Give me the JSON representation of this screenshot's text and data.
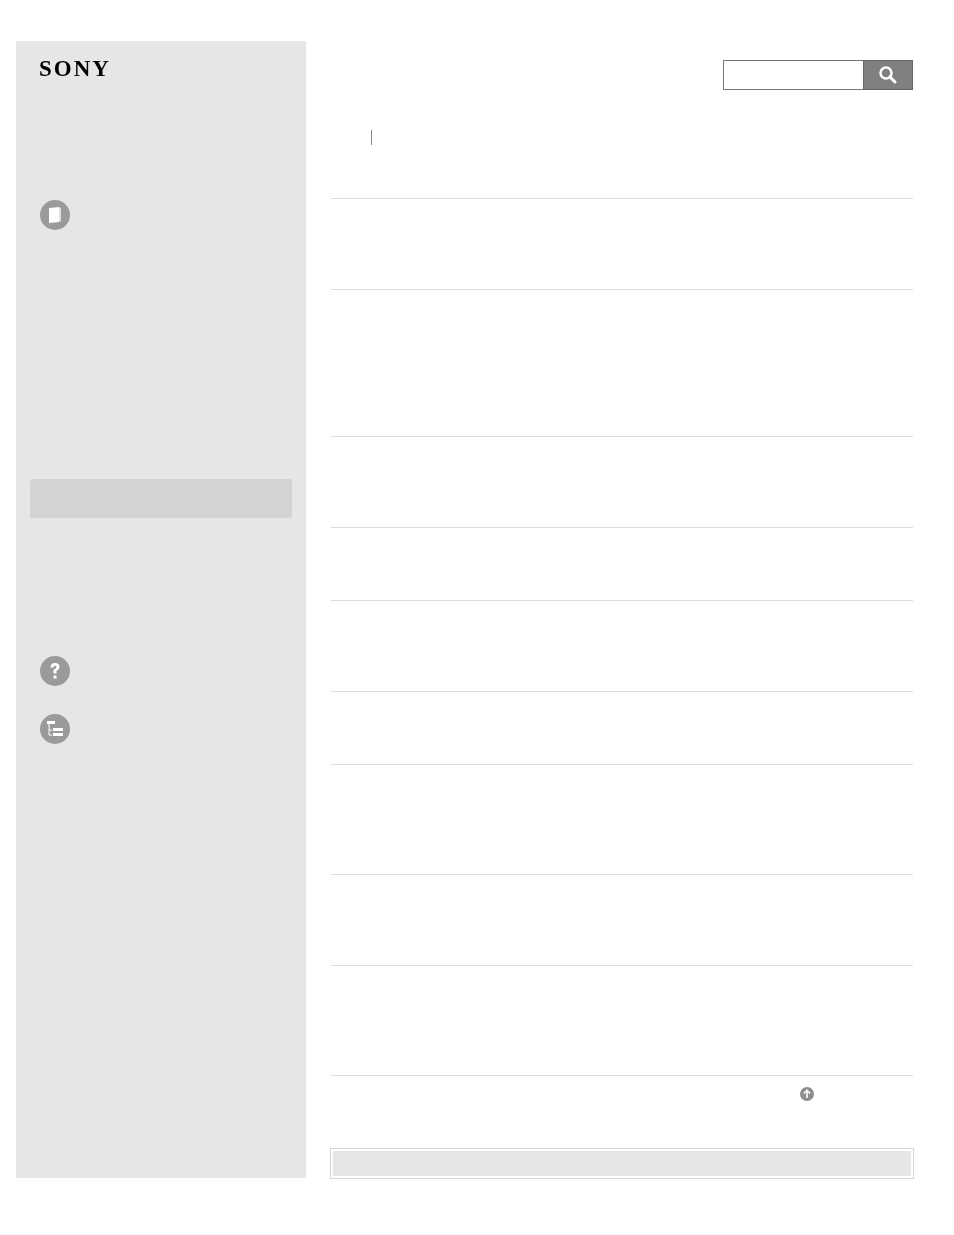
{
  "logo": "SONY"
}
